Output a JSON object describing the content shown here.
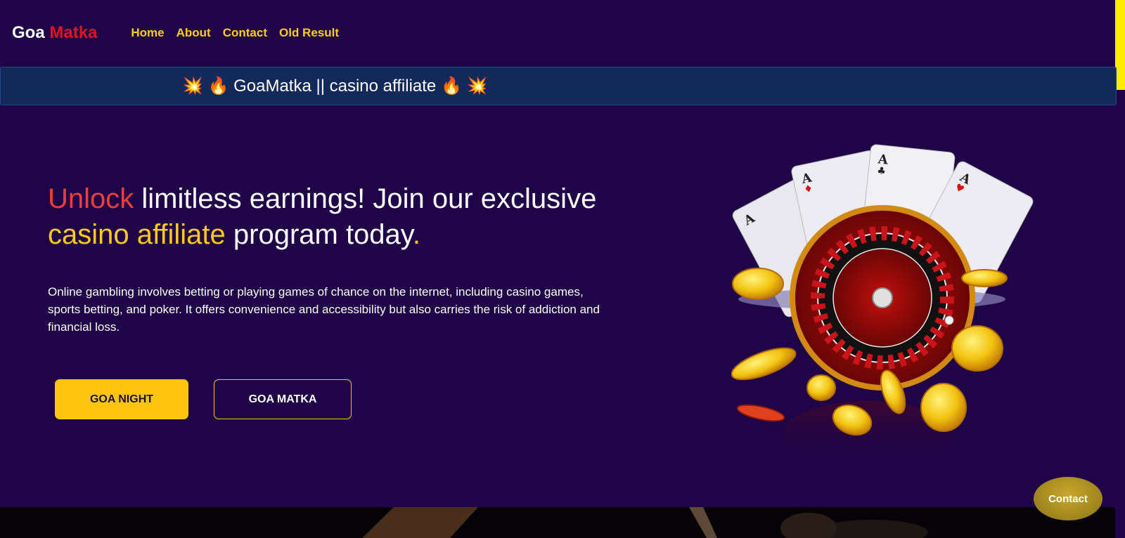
{
  "logo": {
    "part1": "Goa",
    "part2": "Matka"
  },
  "nav": {
    "items": [
      {
        "label": "Home"
      },
      {
        "label": "About"
      },
      {
        "label": "Contact"
      },
      {
        "label": "Old Result"
      }
    ]
  },
  "marquee": {
    "text": "💥 🔥 GoaMatka || casino affiliate 🔥 💥"
  },
  "hero": {
    "title": {
      "w1": "Unlock",
      "w2": " limitless earnings! Join our exclusive ",
      "w3": "casino affiliate",
      "w4": " program today",
      "w5": "."
    },
    "description": "Online gambling involves betting or playing games of chance on the internet, including casino games, sports betting, and poker. It offers convenience and accessibility but also carries the risk of addiction and financial loss."
  },
  "buttons": {
    "goa_night": "GOA NIGHT",
    "goa_matka": "GOA MATKA"
  },
  "contact_fab": "Contact",
  "colors": {
    "background": "#1f0447",
    "nav_gold": "#ffcc1a",
    "primary_button": "#ffc40c",
    "accent_red": "#ef3d3d",
    "marquee_bg": "#13295a"
  },
  "illustration": {
    "icon": "casino-roulette-illustration"
  }
}
